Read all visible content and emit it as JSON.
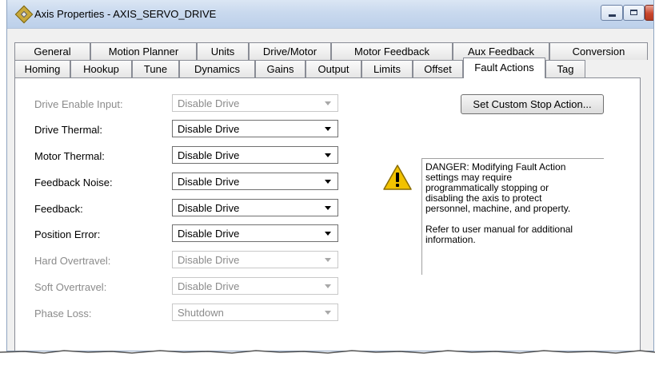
{
  "window": {
    "title": "Axis Properties - AXIS_SERVO_DRIVE",
    "controls": {
      "minimize": "minimize",
      "maximize": "maximize",
      "close": "X"
    }
  },
  "tabs": {
    "row1": [
      "General",
      "Motion Planner",
      "Units",
      "Drive/Motor",
      "Motor Feedback",
      "Aux Feedback",
      "Conversion"
    ],
    "row2": [
      "Homing",
      "Hookup",
      "Tune",
      "Dynamics",
      "Gains",
      "Output",
      "Limits",
      "Offset",
      "Fault Actions",
      "Tag"
    ],
    "active": "Fault Actions"
  },
  "fields": [
    {
      "label": "Drive Enable Input:",
      "value": "Disable Drive",
      "enabled": false
    },
    {
      "label": "Drive Thermal:",
      "value": "Disable Drive",
      "enabled": true
    },
    {
      "label": "Motor Thermal:",
      "value": "Disable Drive",
      "enabled": true
    },
    {
      "label": "Feedback Noise:",
      "value": "Disable Drive",
      "enabled": true
    },
    {
      "label": "Feedback:",
      "value": "Disable Drive",
      "enabled": true
    },
    {
      "label": "Position Error:",
      "value": "Disable Drive",
      "enabled": true
    },
    {
      "label": "Hard Overtravel:",
      "value": "Disable Drive",
      "enabled": false
    },
    {
      "label": "Soft Overtravel:",
      "value": "Disable Drive",
      "enabled": false
    },
    {
      "label": "Phase Loss:",
      "value": "Shutdown",
      "enabled": false
    }
  ],
  "buttons": {
    "custom_stop": "Set Custom Stop Action..."
  },
  "warning": {
    "icon": "warning-triangle-icon",
    "danger_lines": [
      "DANGER: Modifying Fault Action",
      "settings may require",
      "programmatically stopping or",
      "disabling the axis to protect",
      "personnel, machine, and property."
    ],
    "refer_lines": [
      "Refer to user manual for additional",
      "information."
    ]
  },
  "colors": {
    "titlebar": "#c9d9ee",
    "close_button": "#c9462d",
    "warning_yellow": "#f2c200"
  }
}
